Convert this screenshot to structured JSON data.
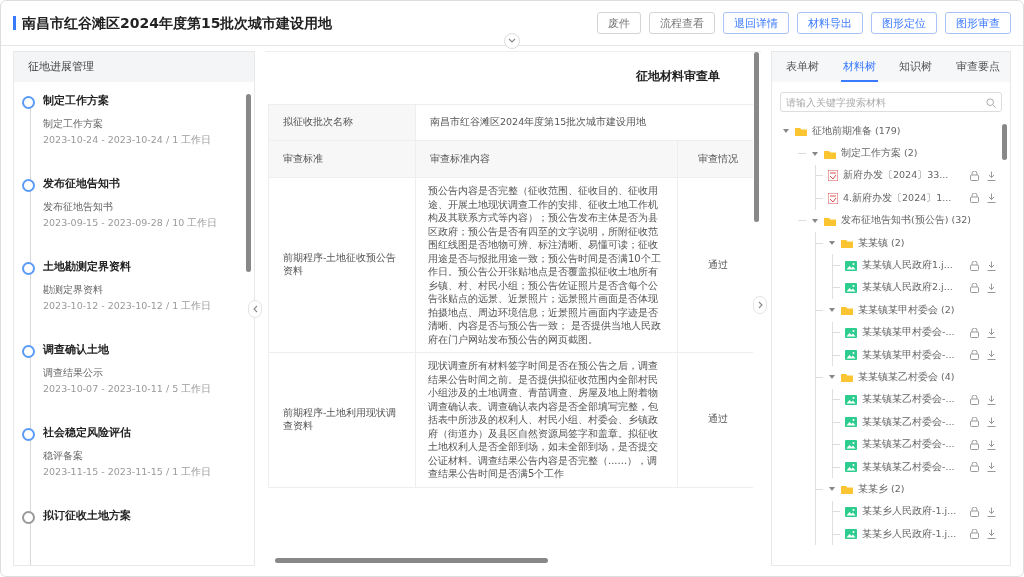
{
  "header": {
    "title": "南昌市红谷滩区2024年度第15批次城市建设用地",
    "buttons": [
      {
        "label": "废件",
        "kind": "default"
      },
      {
        "label": "流程查看",
        "kind": "default"
      },
      {
        "label": "退回详情",
        "kind": "primary"
      },
      {
        "label": "材料导出",
        "kind": "primary"
      },
      {
        "label": "图形定位",
        "kind": "primary"
      },
      {
        "label": "图形审查",
        "kind": "primary"
      }
    ]
  },
  "progress": {
    "title": "征地进展管理",
    "steps": [
      {
        "title": "制定工作方案",
        "task": "制定工作方案",
        "dates": "2023-10-24 - 2023-10-24 / 1 工作日",
        "done": true
      },
      {
        "title": "发布征地告知书",
        "task": "发布征地告知书",
        "dates": "2023-09-15 - 2023-09-28 / 10 工作日",
        "done": true
      },
      {
        "title": "土地勘测定界资料",
        "task": "勘测定界资料",
        "dates": "2023-10-12 - 2023-10-12 / 1 工作日",
        "done": true
      },
      {
        "title": "调查确认土地",
        "task": "调查结果公示",
        "dates": "2023-10-07 - 2023-10-11 / 5 工作日",
        "done": true
      },
      {
        "title": "社会稳定风险评估",
        "task": "稳评备案",
        "dates": "2023-11-15 - 2023-11-15 / 1 工作日",
        "done": true
      },
      {
        "title": "拟订征收土地方案",
        "done": false
      }
    ]
  },
  "review_sheet": {
    "title": "征地材料审查单",
    "batch_label": "拟征收批次名称",
    "batch_value": "南昌市红谷滩区2024年度第15批次城市建设用地",
    "columns": [
      "审查标准",
      "审查标准内容",
      "审查情况"
    ],
    "rows": [
      {
        "standard": "前期程序-土地征收预公告资料",
        "content": "预公告内容是否完整（征收范围、征收目的、征收用途、开展土地现状调查工作的安排、征收土地工作机构及其联系方式等内容）；预公告发布主体是否为县区政府；预公告是否有四至的文字说明，所附征收范围红线图是否地物可辨、标注清晰、易懂可读；征收用途是否与报批用途一致；预公告时间是否满10个工作日。预公告公开张贴地点是否覆盖拟征收土地所有乡镇、村、村民小组；预公告佐证照片是否含每个公告张贴点的远景、近景照片；远景照片画面是否体现拍摄地点、周边环境信息；近景照片画面内字迹是否清晰、内容是否与预公告一致； 是否提供当地人民政府在门户网站发布预公告的网页截图。",
        "result": "通过"
      },
      {
        "standard": "前期程序-土地利用现状调查资料",
        "content": "现状调查所有材料签字时间是否在预公告之后，调查结果公告时间之前。是否提供拟征收范围内全部村民小组涉及的土地调查、青苗调查、房屋及地上附着物调查确认表。调查确认表内容是否全部填写完整，包括表中所涉及的权利人、村民小组、村委会、乡镇政府（街道办）及县区自然资源局签字和盖章。拟征收土地权利人是否全部到场，如未全部到场，是否提交公证材料。调查结果公告内容是否完整（......），调查结果公告时间是否满5个工作",
        "result": "通过"
      }
    ]
  },
  "material_panel": {
    "tabs": [
      {
        "label": "表单树",
        "selected": false
      },
      {
        "label": "材料树",
        "selected": true
      },
      {
        "label": "知识树",
        "selected": false
      },
      {
        "label": "审查要点",
        "selected": false
      }
    ],
    "search": {
      "placeholder": "请输入关键字搜索材料"
    },
    "tree": [
      {
        "kind": "folder",
        "label": "征地前期准备 (179)",
        "expanded": true,
        "children": [
          {
            "kind": "folder",
            "label": "制定工作方案 (2)",
            "expanded": true,
            "children": [
              {
                "kind": "pdf",
                "label": "新府办发〔2024〕33..."
              },
              {
                "kind": "pdf",
                "label": "4.新府办发〔2024〕1..."
              }
            ]
          },
          {
            "kind": "folder",
            "label": "发布征地告知书(预公告) (32)",
            "expanded": true,
            "children": [
              {
                "kind": "folder",
                "label": "某某镇 (2)",
                "expanded": true,
                "children": [
                  {
                    "kind": "image",
                    "label": "某某镇人民政府1.j..."
                  },
                  {
                    "kind": "image",
                    "label": "某某镇人民政府2.j..."
                  }
                ]
              },
              {
                "kind": "folder",
                "label": "某某镇某甲村委会 (2)",
                "expanded": true,
                "children": [
                  {
                    "kind": "image",
                    "label": "某某镇某甲村委会-..."
                  },
                  {
                    "kind": "image",
                    "label": "某某镇某甲村委会-..."
                  }
                ]
              },
              {
                "kind": "folder",
                "label": "某某镇某乙村委会 (4)",
                "expanded": true,
                "children": [
                  {
                    "kind": "image",
                    "label": "某某镇某乙村委会-..."
                  },
                  {
                    "kind": "image",
                    "label": "某某镇某乙村委会-..."
                  },
                  {
                    "kind": "image",
                    "label": "某某镇某乙村委会-..."
                  },
                  {
                    "kind": "image",
                    "label": "某某镇某乙村委会-..."
                  }
                ]
              },
              {
                "kind": "folder",
                "label": "某某乡 (2)",
                "expanded": true,
                "children": [
                  {
                    "kind": "image",
                    "label": "某某乡人民政府-1.j..."
                  },
                  {
                    "kind": "image",
                    "label": "某某乡人民政府-1.j..."
                  }
                ]
              }
            ]
          }
        ]
      }
    ]
  }
}
